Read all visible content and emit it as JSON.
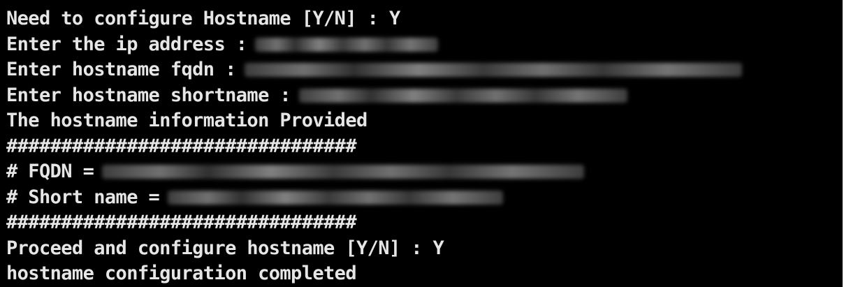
{
  "terminal": {
    "lines": {
      "l1": "Need to configure Hostname [Y/N] : Y",
      "l2": "Enter the ip address :",
      "l3": "Enter hostname fqdn :",
      "l4": "Enter hostname shortname :",
      "l5": "The hostname information Provided",
      "l6": "################################",
      "l7": "# FQDN =",
      "l8": "# Short name =",
      "l9": "################################",
      "l10": "Proceed and configure hostname [Y/N] : Y",
      "l11": "hostname configuration completed"
    }
  }
}
